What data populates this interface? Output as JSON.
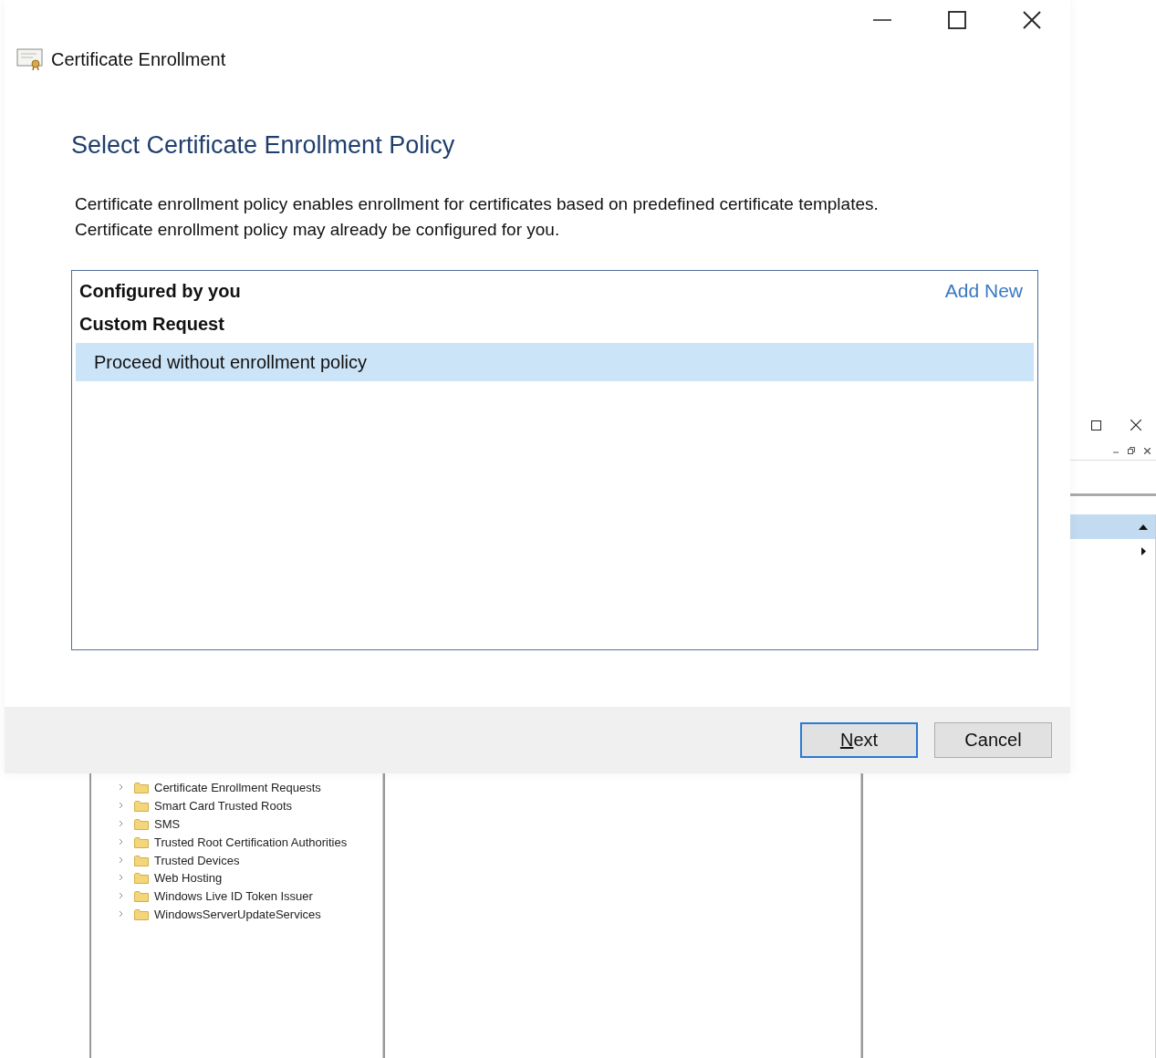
{
  "background_window": {
    "tree": {
      "items": [
        {
          "label": "Certificate Enrollment Requests",
          "expanded": false
        },
        {
          "label": "Smart Card Trusted Roots",
          "expanded": false
        },
        {
          "label": "SMS",
          "expanded": false
        },
        {
          "label": "Trusted Root Certification Authorities",
          "expanded": false
        },
        {
          "label": "Trusted Devices",
          "expanded": false
        },
        {
          "label": "Web Hosting",
          "expanded": false
        },
        {
          "label": "Windows Live ID Token Issuer",
          "expanded": false
        },
        {
          "label": "WindowsServerUpdateServices",
          "expanded": false
        }
      ]
    }
  },
  "dialog": {
    "title": "Certificate Enrollment",
    "heading": "Select Certificate Enrollment Policy",
    "description": [
      "Certificate enrollment policy enables enrollment for certificates based on predefined certificate templates.",
      "Certificate enrollment policy may already be configured for you."
    ],
    "policy_list": {
      "groups": [
        {
          "label": "Configured by you",
          "action": "Add New"
        },
        {
          "label": "Custom Request",
          "items": [
            {
              "label": "Proceed without enrollment policy",
              "selected": true
            }
          ]
        }
      ]
    },
    "buttons": [
      {
        "label": "Next",
        "default": true,
        "mnemonic": true
      },
      {
        "label": "Cancel",
        "default": false,
        "mnemonic": false
      }
    ]
  }
}
